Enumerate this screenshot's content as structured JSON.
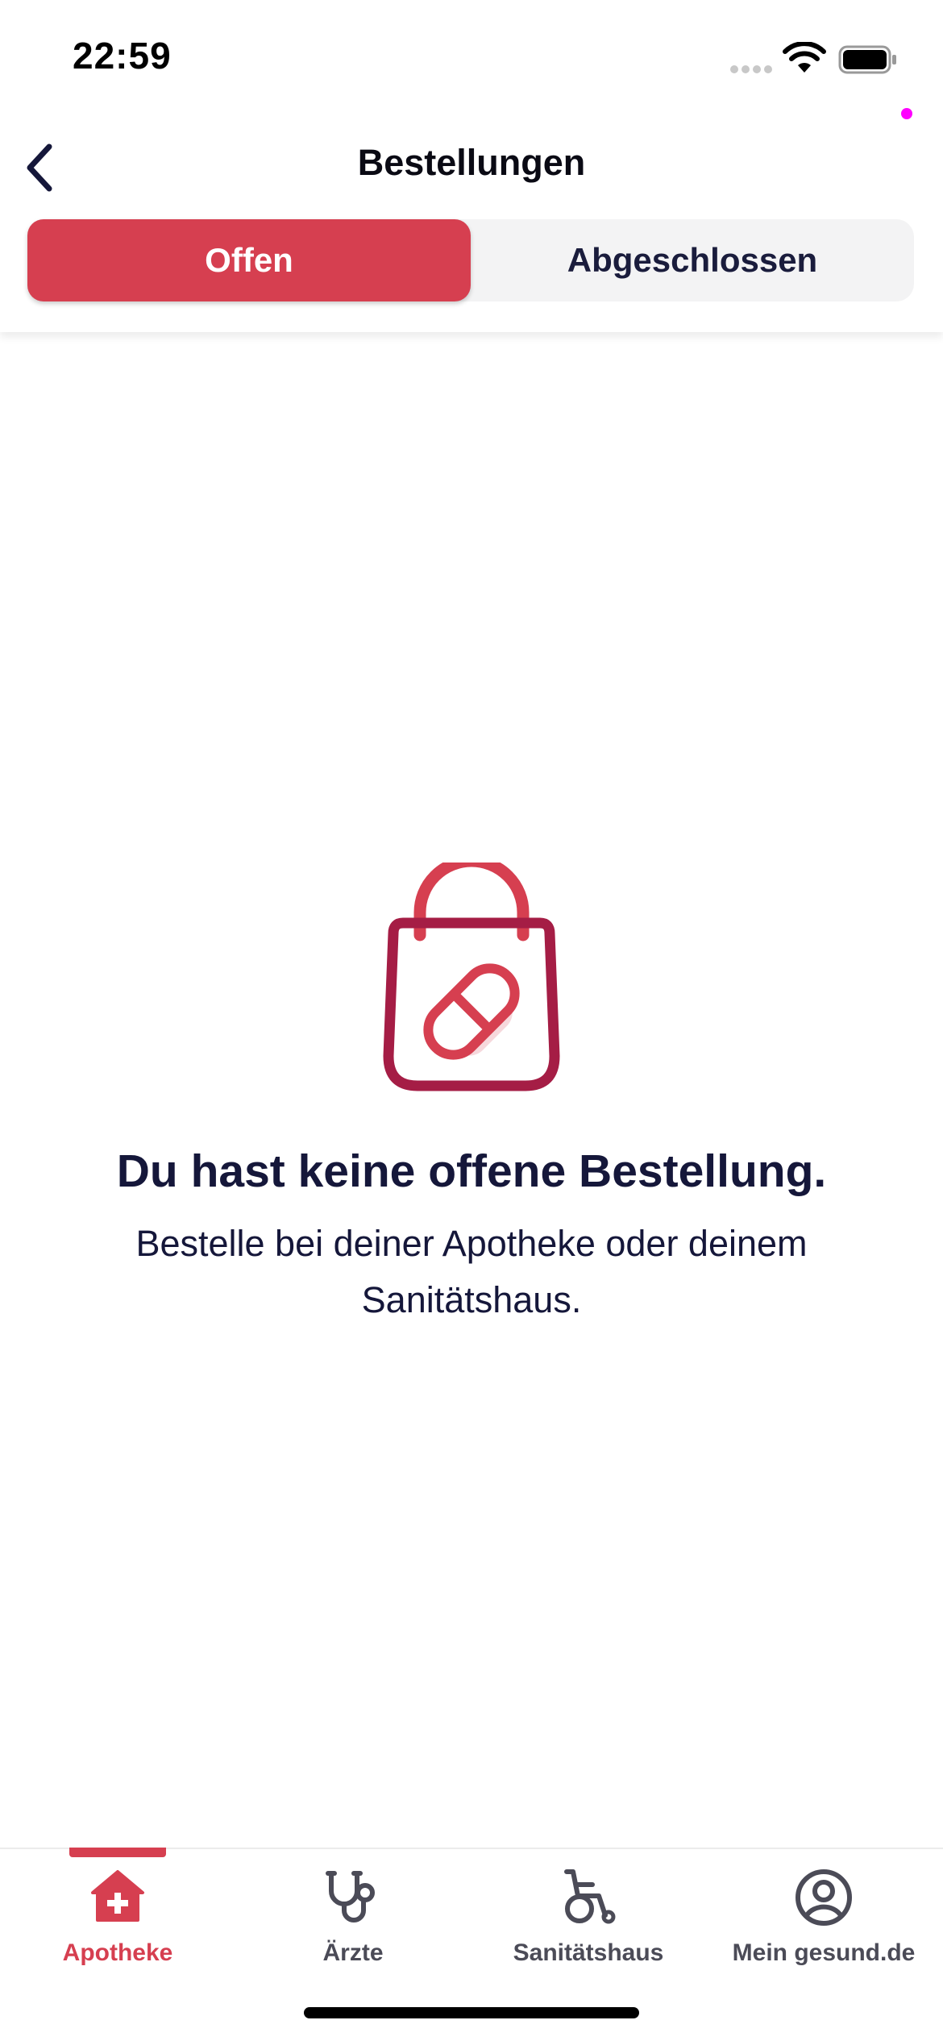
{
  "status_bar": {
    "time": "22:59"
  },
  "header": {
    "title": "Bestellungen",
    "back_icon": "chevron-left-icon"
  },
  "segments": {
    "open_label": "Offen",
    "closed_label": "Abgeschlossen",
    "selected": "Offen"
  },
  "empty_state": {
    "icon": "shopping-bag-pill-icon",
    "title": "Du hast keine offene Bestellung.",
    "text": "Bestelle bei deiner Apotheke oder deinem Sanitätshaus."
  },
  "tab_bar": {
    "items": [
      {
        "label": "Apotheke",
        "icon": "pharmacy-icon",
        "active": true
      },
      {
        "label": "Ärzte",
        "icon": "stethoscope-icon",
        "active": false
      },
      {
        "label": "Sanitätshaus",
        "icon": "wheelchair-icon",
        "active": false
      },
      {
        "label": "Mein gesund.de",
        "icon": "user-profile-icon",
        "active": false
      }
    ]
  },
  "colors": {
    "accent": "#d63f50",
    "accent_dark": "#a51d45",
    "text": "#15173a",
    "segment_bg": "#f3f3f4"
  }
}
